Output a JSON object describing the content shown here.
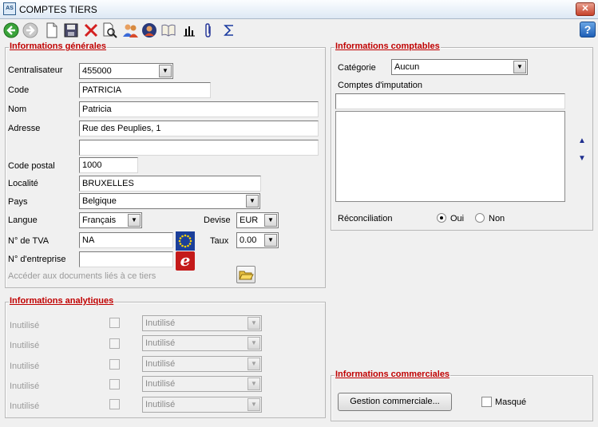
{
  "window": {
    "title": "COMPTES TIERS",
    "app_icon": "AS",
    "close": "✕"
  },
  "toolbar": {
    "icons": [
      "back-icon",
      "forward-icon",
      "new-document-icon",
      "save-icon",
      "delete-icon",
      "search-document-icon",
      "users-icon",
      "contact-icon",
      "book-icon",
      "chart-icon",
      "paperclip-icon",
      "sigma-icon"
    ],
    "help_label": "?"
  },
  "general": {
    "title": "Informations générales",
    "centralisateur_label": "Centralisateur",
    "centralisateur_value": "455000",
    "code_label": "Code",
    "code_value": "PATRICIA",
    "nom_label": "Nom",
    "nom_value": "Patricia",
    "adresse_label": "Adresse",
    "adresse_value": "Rue des Peuplies, 1",
    "adresse2_value": "",
    "cp_label": "Code postal",
    "cp_value": "1000",
    "localite_label": "Localité",
    "localite_value": "BRUXELLES",
    "pays_label": "Pays",
    "pays_value": "Belgique",
    "langue_label": "Langue",
    "langue_value": "Français",
    "devise_label": "Devise",
    "devise_value": "EUR",
    "tva_label": "N° de TVA",
    "tva_value": "NA",
    "taux_label": "Taux",
    "taux_value": "0.00",
    "entreprise_label": "N° d'entreprise",
    "entreprise_value": "",
    "docs_label": "Accéder aux documents liés à ce tiers",
    "eu_badge_text": "e"
  },
  "analytique": {
    "title": "Informations analytiques",
    "rows": [
      {
        "label": "Inutilisé",
        "value": "Inutilisé"
      },
      {
        "label": "Inutilisé",
        "value": "Inutilisé"
      },
      {
        "label": "Inutilisé",
        "value": "Inutilisé"
      },
      {
        "label": "Inutilisé",
        "value": "Inutilisé"
      },
      {
        "label": "Inutilisé",
        "value": "Inutilisé"
      }
    ]
  },
  "comptable": {
    "title": "Informations comptables",
    "categorie_label": "Catégorie",
    "categorie_value": "Aucun",
    "comptes_label": "Comptes d'imputation",
    "comptes_input": "",
    "reconciliation_label": "Réconciliation",
    "oui_label": "Oui",
    "non_label": "Non",
    "reconciliation_selected": "Oui"
  },
  "commercial": {
    "title": "Informations commerciales",
    "button_label": "Gestion commerciale...",
    "masque_label": "Masqué"
  }
}
